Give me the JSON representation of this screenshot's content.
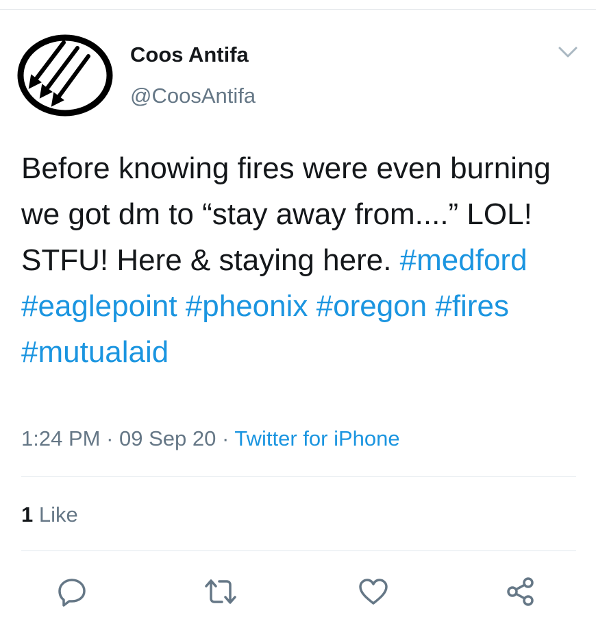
{
  "tweet": {
    "author": {
      "name": "Coos Antifa",
      "handle": "@CoosAntifa",
      "avatar_icon": "three-arrows-icon"
    },
    "text_plain": "Before knowing fires were even burning we got dm to “stay away from....” LOL! STFU! Here & staying here.",
    "hashtags": [
      "#medford",
      "#eaglepoint",
      "#pheonix",
      "#oregon",
      "#fires",
      "#mutualaid"
    ],
    "time": "1:24 PM",
    "date": "09 Sep 20",
    "separator": "·",
    "source": "Twitter for iPhone",
    "likes": {
      "count": "1",
      "label": "Like"
    }
  },
  "actions": {
    "reply_icon": "reply-icon",
    "retweet_icon": "retweet-icon",
    "like_icon": "heart-icon",
    "share_icon": "share-icon"
  },
  "colors": {
    "text": "#14171a",
    "secondary": "#657786",
    "link": "#1b95e0",
    "divider": "#e1e8ed",
    "icon": "#657786"
  }
}
